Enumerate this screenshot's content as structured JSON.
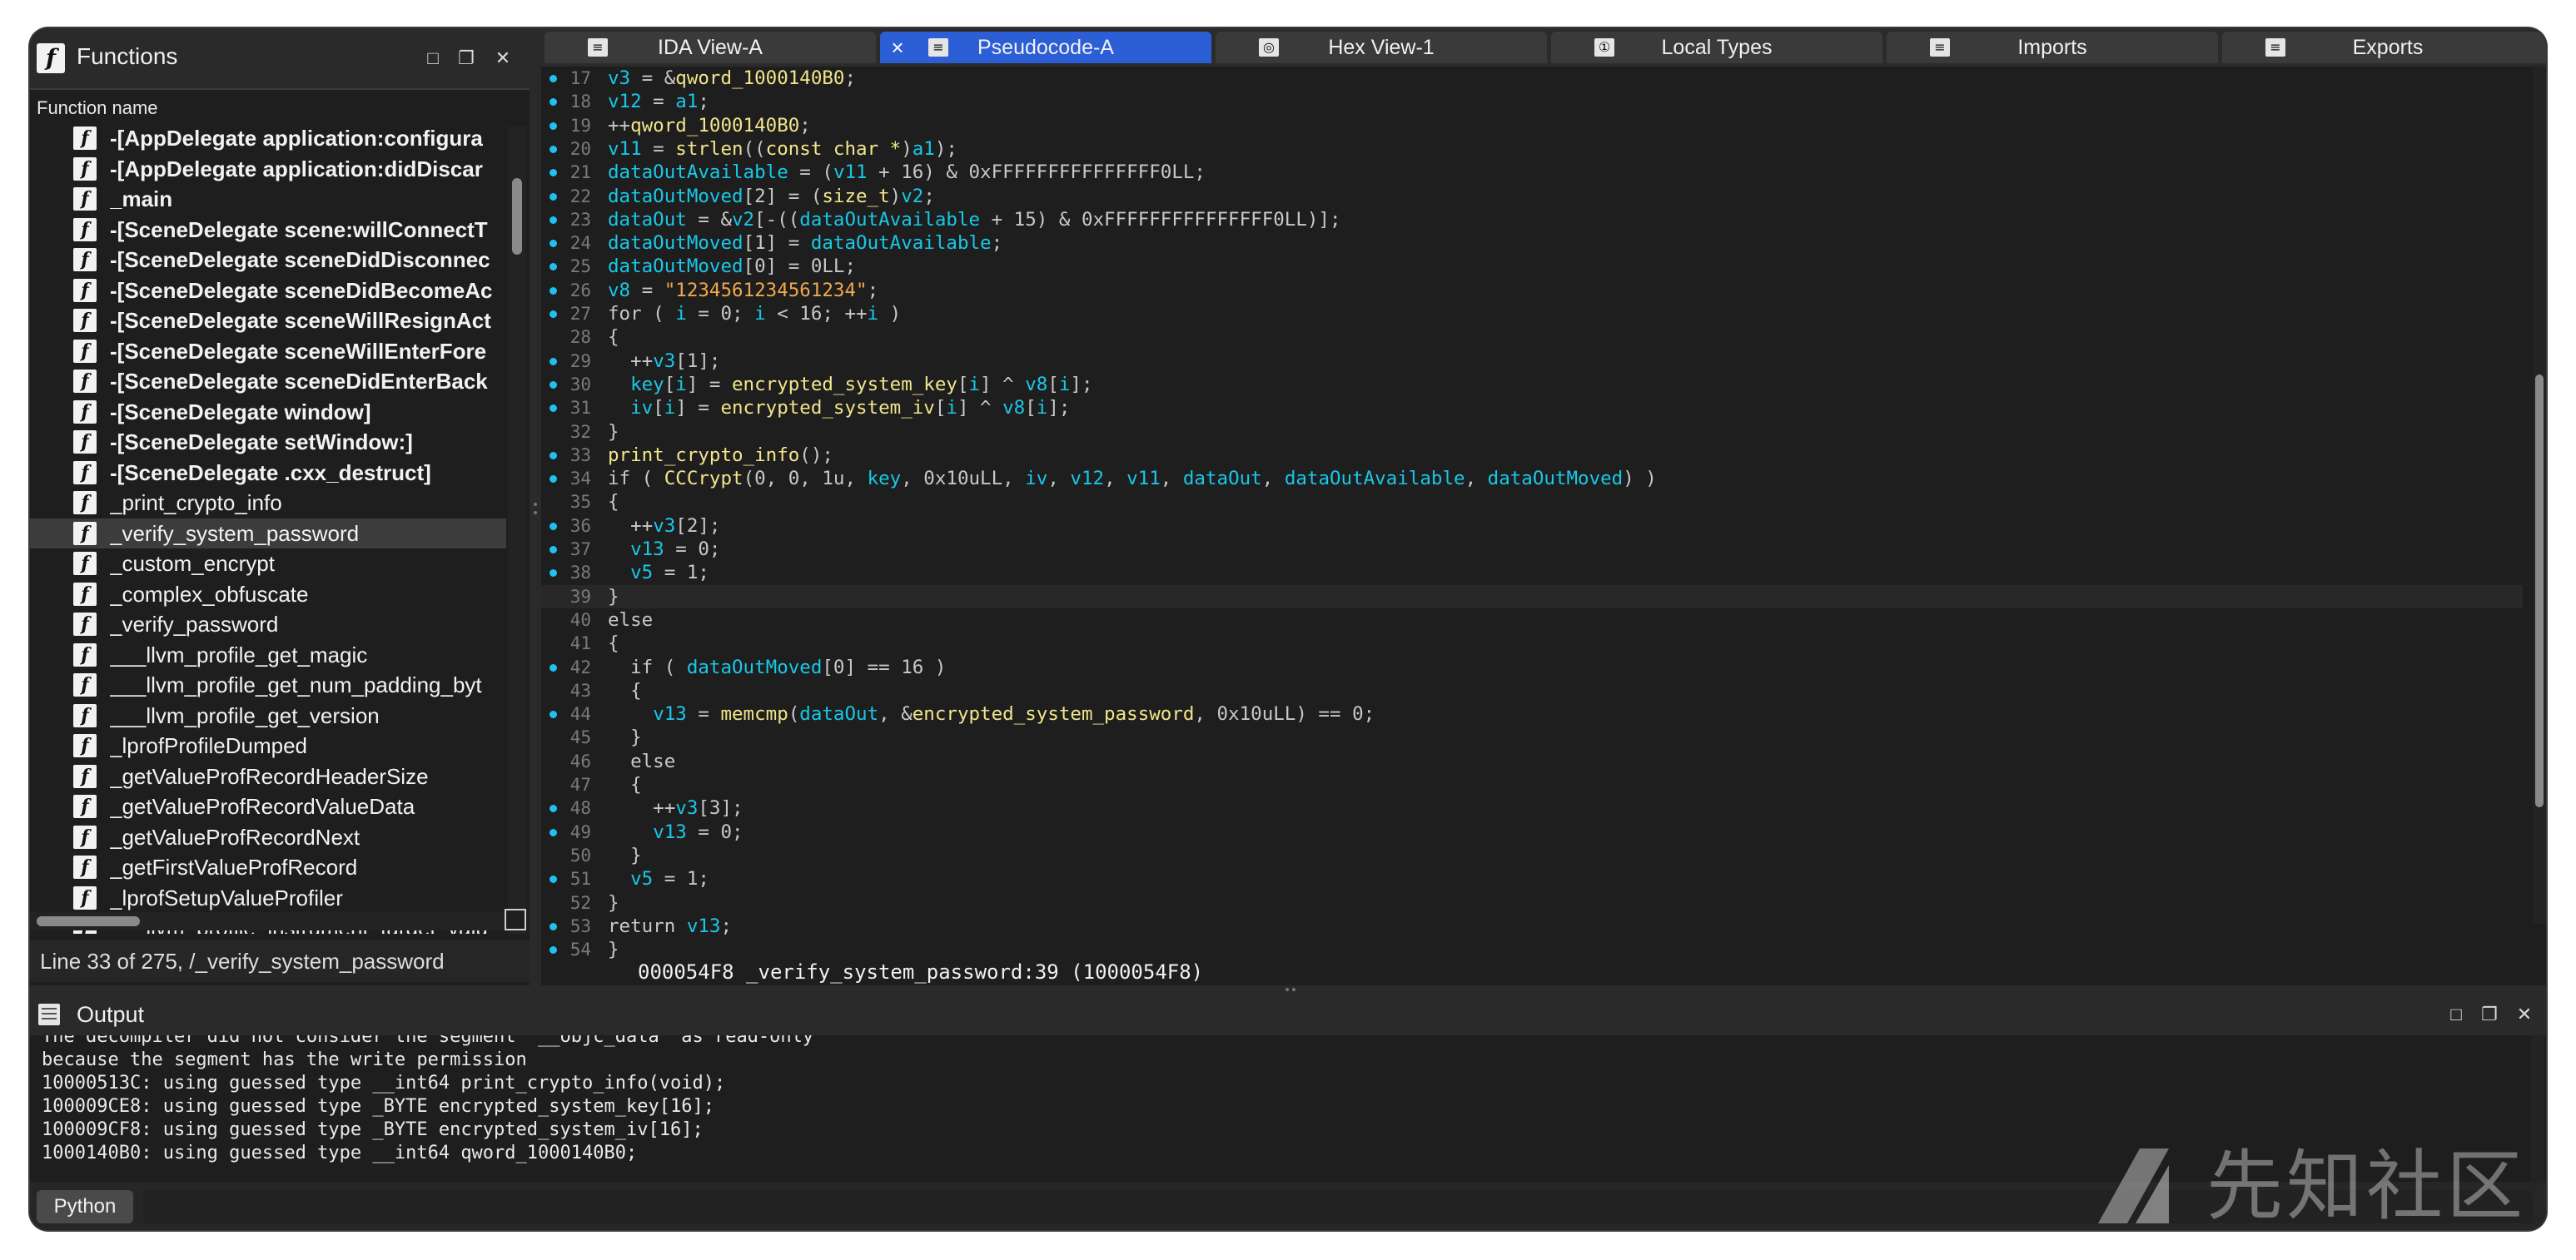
{
  "functions_panel": {
    "title": "Functions",
    "column_header": "Function name",
    "status": "Line 33 of 275, /_verify_system_password",
    "items": [
      {
        "name": "-[AppDelegate application:configura",
        "bold": true
      },
      {
        "name": "-[AppDelegate application:didDiscar",
        "bold": true
      },
      {
        "name": "_main",
        "bold": true
      },
      {
        "name": "-[SceneDelegate scene:willConnectT",
        "bold": true
      },
      {
        "name": "-[SceneDelegate sceneDidDisconnec",
        "bold": true
      },
      {
        "name": "-[SceneDelegate sceneDidBecomeAc",
        "bold": true
      },
      {
        "name": "-[SceneDelegate sceneWillResignAct",
        "bold": true
      },
      {
        "name": "-[SceneDelegate sceneWillEnterFore",
        "bold": true
      },
      {
        "name": "-[SceneDelegate sceneDidEnterBack",
        "bold": true
      },
      {
        "name": "-[SceneDelegate window]",
        "bold": true
      },
      {
        "name": "-[SceneDelegate setWindow:]",
        "bold": true
      },
      {
        "name": "-[SceneDelegate .cxx_destruct]",
        "bold": true
      },
      {
        "name": "_print_crypto_info",
        "bold": false
      },
      {
        "name": "_verify_system_password",
        "bold": false,
        "selected": true
      },
      {
        "name": "_custom_encrypt",
        "bold": false
      },
      {
        "name": "_complex_obfuscate",
        "bold": false
      },
      {
        "name": "_verify_password",
        "bold": false
      },
      {
        "name": "___llvm_profile_get_magic",
        "bold": false
      },
      {
        "name": "___llvm_profile_get_num_padding_byt",
        "bold": false
      },
      {
        "name": "___llvm_profile_get_version",
        "bold": false
      },
      {
        "name": "_lprofProfileDumped",
        "bold": false
      },
      {
        "name": "_getValueProfRecordHeaderSize",
        "bold": false
      },
      {
        "name": "_getValueProfRecordValueData",
        "bold": false
      },
      {
        "name": "_getValueProfRecordNext",
        "bold": false
      },
      {
        "name": "_getFirstValueProfRecord",
        "bold": false
      },
      {
        "name": "_lprofSetupValueProfiler",
        "bold": false
      },
      {
        "name": "___llvm_profile_instrument_target_valu",
        "bold": false
      }
    ]
  },
  "tabs": [
    {
      "label": "IDA View-A",
      "active": false,
      "icon": "grid-icon"
    },
    {
      "label": "Pseudocode-A",
      "active": true,
      "icon": "grid-icon"
    },
    {
      "label": "Hex View-1",
      "active": false,
      "icon": "hex-icon"
    },
    {
      "label": "Local Types",
      "active": false,
      "icon": "types-icon"
    },
    {
      "label": "Imports",
      "active": false,
      "icon": "imports-icon"
    },
    {
      "label": "Exports",
      "active": false,
      "icon": "exports-icon"
    }
  ],
  "pseudocode": {
    "current_line": 39,
    "address_line": "000054F8 _verify_system_password:39 (1000054F8)",
    "lines": [
      {
        "n": "17",
        "bp": true,
        "t": [
          [
            "v3",
            "var"
          ],
          [
            " = &",
            ""
          ],
          [
            "qword_1000140B0",
            "glb"
          ],
          [
            ";",
            ""
          ]
        ]
      },
      {
        "n": "18",
        "bp": true,
        "t": [
          [
            "v12",
            "var"
          ],
          [
            " = ",
            ""
          ],
          [
            "a1",
            "var"
          ],
          [
            ";",
            ""
          ]
        ]
      },
      {
        "n": "19",
        "bp": true,
        "t": [
          [
            "++",
            ""
          ],
          [
            "qword_1000140B0",
            "glb"
          ],
          [
            ";",
            ""
          ]
        ]
      },
      {
        "n": "20",
        "bp": true,
        "t": [
          [
            "v11",
            "var"
          ],
          [
            " = ",
            ""
          ],
          [
            "strlen",
            "fn"
          ],
          [
            "((",
            ""
          ],
          [
            "const char *",
            "typ"
          ],
          [
            ")",
            ""
          ],
          [
            "a1",
            "var"
          ],
          [
            ");",
            ""
          ]
        ]
      },
      {
        "n": "21",
        "bp": true,
        "t": [
          [
            "dataOutAvailable",
            "var"
          ],
          [
            " = (",
            ""
          ],
          [
            "v11",
            "var"
          ],
          [
            " + 16) & 0xFFFFFFFFFFFFFFF0LL;",
            ""
          ]
        ]
      },
      {
        "n": "22",
        "bp": true,
        "t": [
          [
            "dataOutMoved",
            "var"
          ],
          [
            "[2] = (",
            ""
          ],
          [
            "size_t",
            "typ"
          ],
          [
            ")",
            ""
          ],
          [
            "v2",
            "var"
          ],
          [
            ";",
            ""
          ]
        ]
      },
      {
        "n": "23",
        "bp": true,
        "t": [
          [
            "dataOut",
            "var"
          ],
          [
            " = &",
            ""
          ],
          [
            "v2",
            "var"
          ],
          [
            "[-((",
            ""
          ],
          [
            "dataOutAvailable",
            "var"
          ],
          [
            " + 15) & 0xFFFFFFFFFFFFFFF0LL)];",
            ""
          ]
        ]
      },
      {
        "n": "24",
        "bp": true,
        "t": [
          [
            "dataOutMoved",
            "var"
          ],
          [
            "[1] = ",
            ""
          ],
          [
            "dataOutAvailable",
            "var"
          ],
          [
            ";",
            ""
          ]
        ]
      },
      {
        "n": "25",
        "bp": true,
        "t": [
          [
            "dataOutMoved",
            "var"
          ],
          [
            "[0] = 0LL;",
            ""
          ]
        ]
      },
      {
        "n": "26",
        "bp": true,
        "t": [
          [
            "v8",
            "var"
          ],
          [
            " = ",
            ""
          ],
          [
            "\"1234561234561234\"",
            "str"
          ],
          [
            ";",
            ""
          ]
        ]
      },
      {
        "n": "27",
        "bp": true,
        "t": [
          [
            "for ( ",
            ""
          ],
          [
            "i",
            "var"
          ],
          [
            " = 0; ",
            ""
          ],
          [
            "i",
            "var"
          ],
          [
            " < 16; ++",
            ""
          ],
          [
            "i",
            "var"
          ],
          [
            " )",
            ""
          ]
        ]
      },
      {
        "n": "28",
        "bp": false,
        "t": [
          [
            "{",
            ""
          ]
        ]
      },
      {
        "n": "29",
        "bp": true,
        "t": [
          [
            "  ++",
            ""
          ],
          [
            "v3",
            "var"
          ],
          [
            "[1];",
            ""
          ]
        ]
      },
      {
        "n": "30",
        "bp": true,
        "t": [
          [
            "  ",
            ""
          ],
          [
            "key",
            "var"
          ],
          [
            "[",
            ""
          ],
          [
            "i",
            "var"
          ],
          [
            "] = ",
            ""
          ],
          [
            "encrypted_system_key",
            "glb"
          ],
          [
            "[",
            ""
          ],
          [
            "i",
            "var"
          ],
          [
            "] ^ ",
            ""
          ],
          [
            "v8",
            "var"
          ],
          [
            "[",
            ""
          ],
          [
            "i",
            "var"
          ],
          [
            "];",
            ""
          ]
        ]
      },
      {
        "n": "31",
        "bp": true,
        "t": [
          [
            "  ",
            ""
          ],
          [
            "iv",
            "var"
          ],
          [
            "[",
            ""
          ],
          [
            "i",
            "var"
          ],
          [
            "] = ",
            ""
          ],
          [
            "encrypted_system_iv",
            "glb"
          ],
          [
            "[",
            ""
          ],
          [
            "i",
            "var"
          ],
          [
            "] ^ ",
            ""
          ],
          [
            "v8",
            "var"
          ],
          [
            "[",
            ""
          ],
          [
            "i",
            "var"
          ],
          [
            "];",
            ""
          ]
        ]
      },
      {
        "n": "32",
        "bp": false,
        "t": [
          [
            "}",
            ""
          ]
        ]
      },
      {
        "n": "33",
        "bp": true,
        "t": [
          [
            "print_crypto_info",
            "fn"
          ],
          [
            "();",
            ""
          ]
        ]
      },
      {
        "n": "34",
        "bp": true,
        "t": [
          [
            "if ( ",
            ""
          ],
          [
            "CCCrypt",
            "fn"
          ],
          [
            "(0, 0, 1u, ",
            ""
          ],
          [
            "key",
            "var"
          ],
          [
            ", 0x10uLL, ",
            ""
          ],
          [
            "iv",
            "var"
          ],
          [
            ", ",
            ""
          ],
          [
            "v12",
            "var"
          ],
          [
            ", ",
            ""
          ],
          [
            "v11",
            "var"
          ],
          [
            ", ",
            ""
          ],
          [
            "dataOut",
            "var"
          ],
          [
            ", ",
            ""
          ],
          [
            "dataOutAvailable",
            "var"
          ],
          [
            ", ",
            ""
          ],
          [
            "dataOutMoved",
            "var"
          ],
          [
            ") )",
            ""
          ]
        ]
      },
      {
        "n": "35",
        "bp": false,
        "t": [
          [
            "{",
            ""
          ]
        ]
      },
      {
        "n": "36",
        "bp": true,
        "t": [
          [
            "  ++",
            ""
          ],
          [
            "v3",
            "var"
          ],
          [
            "[2];",
            ""
          ]
        ]
      },
      {
        "n": "37",
        "bp": true,
        "t": [
          [
            "  ",
            ""
          ],
          [
            "v13",
            "var"
          ],
          [
            " = 0;",
            ""
          ]
        ]
      },
      {
        "n": "38",
        "bp": true,
        "t": [
          [
            "  ",
            ""
          ],
          [
            "v5",
            "var"
          ],
          [
            " = 1;",
            ""
          ]
        ]
      },
      {
        "n": "39",
        "bp": false,
        "t": [
          [
            "}",
            ""
          ]
        ]
      },
      {
        "n": "40",
        "bp": false,
        "t": [
          [
            "else",
            ""
          ]
        ]
      },
      {
        "n": "41",
        "bp": false,
        "t": [
          [
            "{",
            ""
          ]
        ]
      },
      {
        "n": "42",
        "bp": true,
        "t": [
          [
            "  if ( ",
            ""
          ],
          [
            "dataOutMoved",
            "var"
          ],
          [
            "[0] == 16 )",
            ""
          ]
        ]
      },
      {
        "n": "43",
        "bp": false,
        "t": [
          [
            "  {",
            ""
          ]
        ]
      },
      {
        "n": "44",
        "bp": true,
        "t": [
          [
            "    ",
            ""
          ],
          [
            "v13",
            "var"
          ],
          [
            " = ",
            ""
          ],
          [
            "memcmp",
            "fn"
          ],
          [
            "(",
            ""
          ],
          [
            "dataOut",
            "var"
          ],
          [
            ", &",
            ""
          ],
          [
            "encrypted_system_password",
            "glb"
          ],
          [
            ", 0x10uLL) == 0;",
            ""
          ]
        ]
      },
      {
        "n": "45",
        "bp": false,
        "t": [
          [
            "  }",
            ""
          ]
        ]
      },
      {
        "n": "46",
        "bp": false,
        "t": [
          [
            "  else",
            ""
          ]
        ]
      },
      {
        "n": "47",
        "bp": false,
        "t": [
          [
            "  {",
            ""
          ]
        ]
      },
      {
        "n": "48",
        "bp": true,
        "t": [
          [
            "    ++",
            ""
          ],
          [
            "v3",
            "var"
          ],
          [
            "[3];",
            ""
          ]
        ]
      },
      {
        "n": "49",
        "bp": true,
        "t": [
          [
            "    ",
            ""
          ],
          [
            "v13",
            "var"
          ],
          [
            " = 0;",
            ""
          ]
        ]
      },
      {
        "n": "50",
        "bp": false,
        "t": [
          [
            "  }",
            ""
          ]
        ]
      },
      {
        "n": "51",
        "bp": true,
        "t": [
          [
            "  ",
            ""
          ],
          [
            "v5",
            "var"
          ],
          [
            " = 1;",
            ""
          ]
        ]
      },
      {
        "n": "52",
        "bp": false,
        "t": [
          [
            "}",
            ""
          ]
        ]
      },
      {
        "n": "53",
        "bp": true,
        "t": [
          [
            "return ",
            ""
          ],
          [
            "v13",
            "var"
          ],
          [
            ";",
            ""
          ]
        ]
      },
      {
        "n": "54",
        "bp": true,
        "t": [
          [
            "}",
            ""
          ]
        ]
      }
    ]
  },
  "output": {
    "title": "Output",
    "lines": [
      "The decompiler did not consider the segment '__objc_data' as read-only",
      "because the segment has the write permission",
      "10000513C: using guessed type __int64 print_crypto_info(void);",
      "100009CE8: using guessed type _BYTE encrypted_system_key[16];",
      "100009CF8: using guessed type _BYTE encrypted_system_iv[16];",
      "1000140B0: using guessed type __int64 qword_1000140B0;"
    ],
    "python_button": "Python"
  },
  "watermark": {
    "text": "先知社区"
  },
  "colors": {
    "accent_tab": "#2c5fd6",
    "breakpoint": "#1ec1f0",
    "variable": "#18c8e8",
    "function": "#f2e58a",
    "string": "#f0a84e"
  }
}
